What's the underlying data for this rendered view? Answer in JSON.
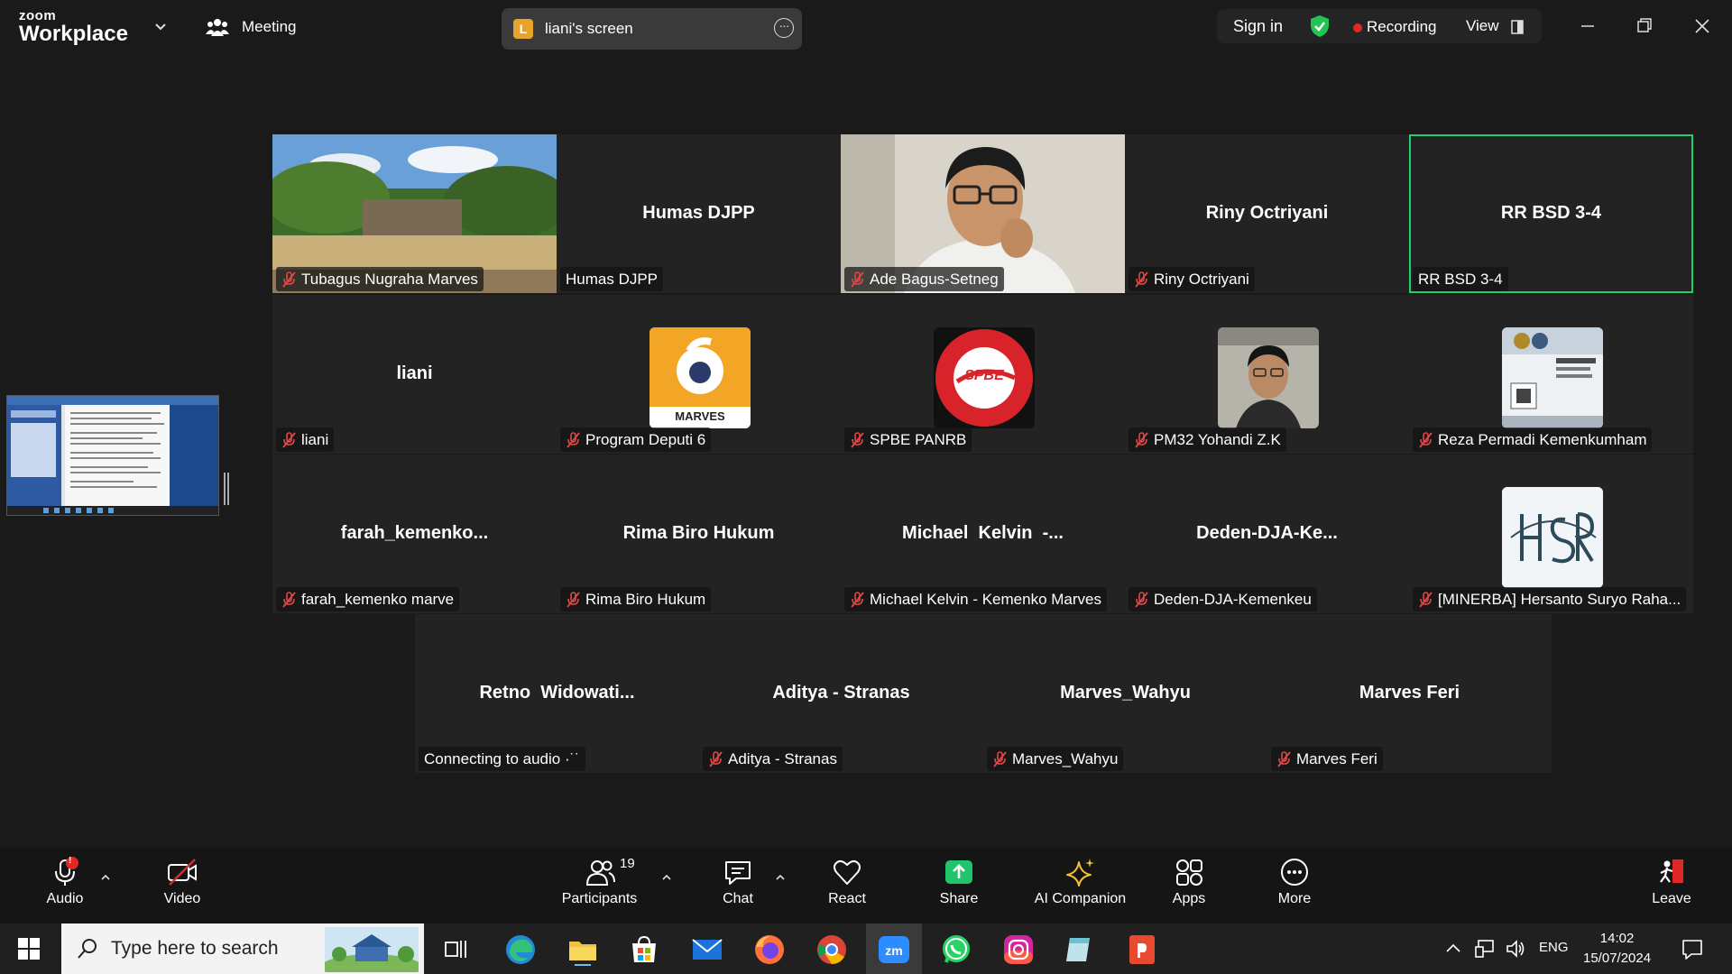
{
  "app": {
    "brand_top": "zoom",
    "brand_bottom": "Workplace"
  },
  "header": {
    "meeting_label": "Meeting",
    "screen_share": {
      "badge": "L",
      "label": "liani's screen"
    },
    "sign_in": "Sign in",
    "recording": "Recording",
    "view": "View"
  },
  "tiles": [
    {
      "big": "",
      "tag": "Tubagus Nugraha Marves",
      "muted": true
    },
    {
      "big": "Humas DJPP",
      "tag": "Humas DJPP",
      "muted": false
    },
    {
      "big": "",
      "tag": "Ade Bagus-Setneg",
      "muted": true
    },
    {
      "big": "Riny Octriyani",
      "tag": "Riny Octriyani",
      "muted": true
    },
    {
      "big": "RR BSD 3-4",
      "tag": "RR BSD 3-4",
      "muted": false
    },
    {
      "big": "liani",
      "tag": "liani",
      "muted": true
    },
    {
      "big": "",
      "tag": "Program Deputi 6",
      "muted": true,
      "avatar_text": "MARVES"
    },
    {
      "big": "",
      "tag": "SPBE PANRB",
      "muted": true,
      "avatar_text": "SPBE"
    },
    {
      "big": "",
      "tag": "PM32 Yohandi Z.K",
      "muted": true
    },
    {
      "big": "",
      "tag": "Reza Permadi Kemenkumham",
      "muted": true
    },
    {
      "big": "farah_kemenko...",
      "tag": "farah_kemenko marve",
      "muted": true
    },
    {
      "big": "Rima Biro Hukum",
      "tag": "Rima Biro Hukum",
      "muted": true
    },
    {
      "big": "Michael  Kelvin  -...",
      "tag": "Michael Kelvin - Kemenko Marves",
      "muted": true
    },
    {
      "big": "Deden-DJA-Ke...",
      "tag": "Deden-DJA-Kemenkeu",
      "muted": true
    },
    {
      "big": "",
      "tag": "[MINERBA] Hersanto Suryo Raha...",
      "muted": true
    },
    {
      "big": "Retno  Widowati...",
      "tag": "Connecting to audio ·˙˙",
      "muted": false
    },
    {
      "big": "Aditya - Stranas",
      "tag": "Aditya - Stranas",
      "muted": true
    },
    {
      "big": "Marves_Wahyu",
      "tag": "Marves_Wahyu",
      "muted": true
    },
    {
      "big": "Marves Feri",
      "tag": "Marves Feri",
      "muted": true
    }
  ],
  "toolbar": {
    "audio": "Audio",
    "audio_badge": "!",
    "video": "Video",
    "participants": "Participants",
    "participants_count": "19",
    "chat": "Chat",
    "react": "React",
    "share": "Share",
    "ai_companion": "AI Companion",
    "apps": "Apps",
    "more": "More",
    "leave": "Leave"
  },
  "taskbar": {
    "search_placeholder": "Type here to search",
    "lang": "ENG",
    "time": "14:02",
    "date": "15/07/2024"
  },
  "colors": {
    "active_speaker": "#22d06a",
    "share": "#1fc46b",
    "recording": "#e02828",
    "mute": "#e04848"
  }
}
